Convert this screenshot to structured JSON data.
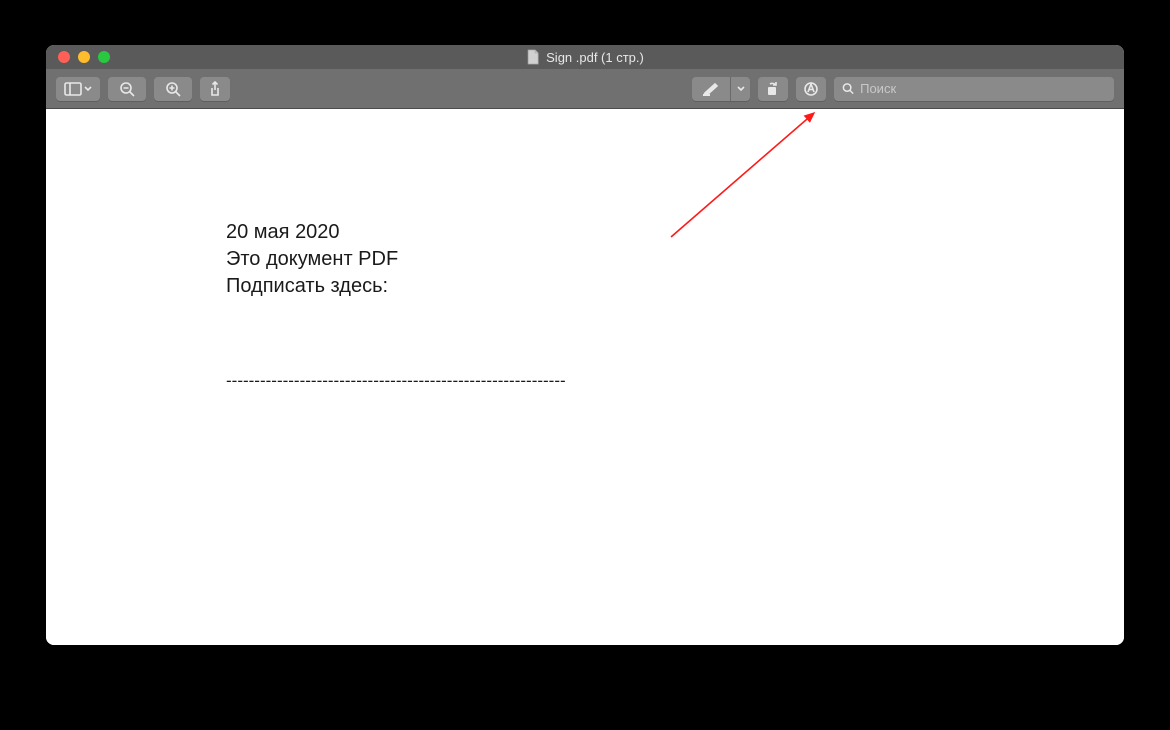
{
  "window": {
    "title": "Sign .pdf (1 стр.)"
  },
  "toolbar": {
    "search_placeholder": "Поиск"
  },
  "document": {
    "line1": "20 мая 2020",
    "line2": "Это документ PDF",
    "line3": "Подписать здесь:",
    "dashes": "------------------------------------------------------------"
  }
}
